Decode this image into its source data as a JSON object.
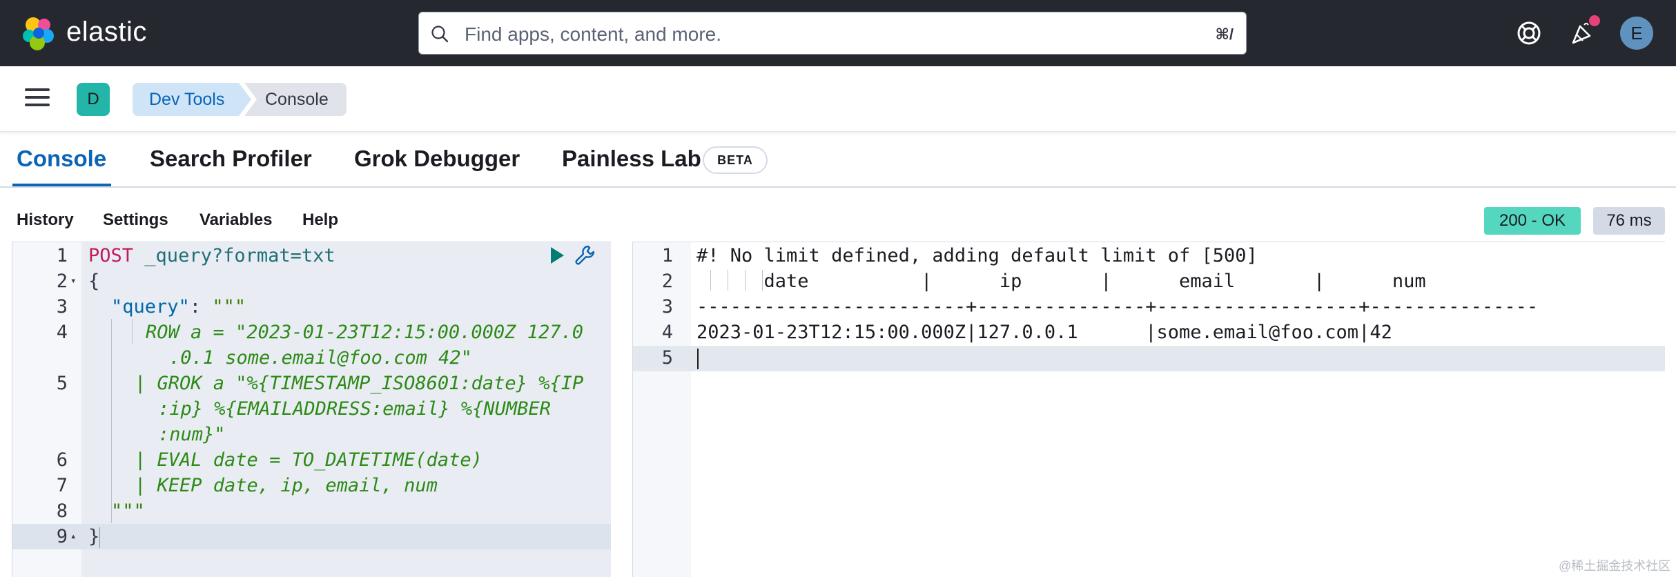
{
  "header": {
    "brand": "elastic",
    "search_placeholder": "Find apps, content, and more.",
    "search_shortcut": "⌘/",
    "user_initial": "E"
  },
  "subheader": {
    "space_initial": "D",
    "breadcrumbs": [
      "Dev Tools",
      "Console"
    ]
  },
  "tabs": [
    {
      "label": "Console",
      "active": true
    },
    {
      "label": "Search Profiler"
    },
    {
      "label": "Grok Debugger"
    },
    {
      "label": "Painless Lab"
    }
  ],
  "beta_badge": "BETA",
  "toolbar": {
    "items": [
      "History",
      "Settings",
      "Variables",
      "Help"
    ],
    "status": "200 - OK",
    "duration": "76 ms"
  },
  "request": {
    "line_numbers": [
      "1",
      "2",
      "3",
      "4",
      "5",
      "6",
      "7",
      "8",
      "9"
    ],
    "method": "POST",
    "path": "_query?format=txt",
    "open_brace": "{",
    "query_key": "\"query\"",
    "colon": ": ",
    "triple_quote": "\"\"\"",
    "row_line_1": "ROW a = \"2023-01-23T12:15:00.000Z 127.0",
    "row_line_2": ".0.1 some.email@foo.com 42\"",
    "grok_line_1": "| GROK a \"%{TIMESTAMP_ISO8601:date} %{IP",
    "grok_line_2": ":ip} %{EMAILADDRESS:email} %{NUMBER",
    "grok_line_3": ":num}\"",
    "eval_line": "| EVAL date = TO_DATETIME(date)",
    "keep_line": "| KEEP date, ip, email, num",
    "close_quote": "\"\"\"",
    "close_brace": "}"
  },
  "response": {
    "line_numbers": [
      "1",
      "2",
      "3",
      "4",
      "5"
    ],
    "lines": [
      "#! No limit defined, adding default limit of [500]",
      "      date          |      ip       |      email       |      num      ",
      "------------------------+---------------+------------------+---------------",
      "2023-01-23T12:15:00.000Z|127.0.0.1      |some.email@foo.com|42",
      ""
    ]
  },
  "watermark": "@稀土掘金技术社区",
  "colors": {
    "header_bg": "#25282f",
    "accent": "#0b64b5",
    "status_ok": "#54d6bf",
    "space_badge": "#23b5a8",
    "avatar": "#6092c0"
  }
}
